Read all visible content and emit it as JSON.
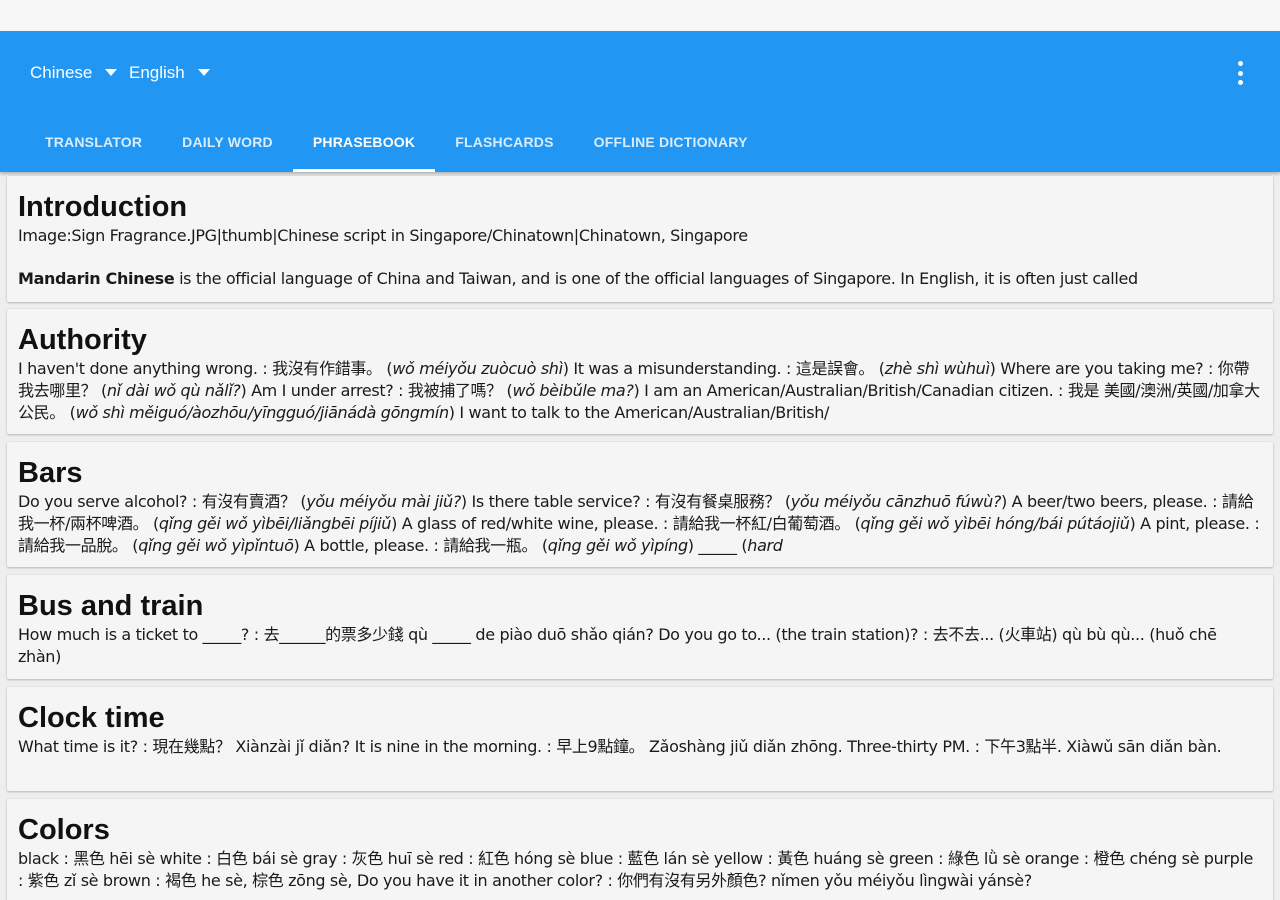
{
  "header": {
    "source_language": "Chinese",
    "target_language": "English",
    "menu_icon": "more-vert-icon",
    "dropdown_icon": "arrow-drop-down-icon",
    "accent_color": "#2196f3"
  },
  "tabs": [
    {
      "label": "TRANSLATOR",
      "active": false
    },
    {
      "label": "DAILY WORD",
      "active": false
    },
    {
      "label": "PHRASEBOOK",
      "active": true
    },
    {
      "label": "FLASHCARDS",
      "active": false
    },
    {
      "label": "OFFLINE DICTIONARY",
      "active": false
    }
  ],
  "sections": [
    {
      "title": "Introduction",
      "body_line": "Image:Sign Fragrance.JPG|thumb|Chinese script in Singapore/Chinatown|Chinatown, Singapore",
      "body_bold": "Mandarin Chinese",
      "body_rest": " is the official language of China and Taiwan, and is one of the official languages of Singapore. In English, it is often just called"
    },
    {
      "title": "Authority",
      "segments": [
        {
          "t": "I haven't done anything wrong. : 我沒有作錯事。 (",
          "i": false
        },
        {
          "t": "wǒ méiyǒu zuòcuò shì",
          "i": true
        },
        {
          "t": ") It was a misunderstanding. : 這是誤會。 (",
          "i": false
        },
        {
          "t": "zhè shì wùhuì",
          "i": true
        },
        {
          "t": ") Where are you taking me? : 你帶我去哪里？ (",
          "i": false
        },
        {
          "t": "nǐ dài wǒ qù nǎlǐ?",
          "i": true
        },
        {
          "t": ") Am I under arrest? : 我被捕了嗎？ (",
          "i": false
        },
        {
          "t": "wǒ bèibǔle ma?",
          "i": true
        },
        {
          "t": ") I am an American/Australian/British/Canadian citizen. : 我是 美國/澳洲/英國/加拿大 公民。 (",
          "i": false
        },
        {
          "t": "wǒ shì měiguó/àozhōu/yīngguó/jiānádà gōngmín",
          "i": true
        },
        {
          "t": ") I want to talk to the American/Australian/British/",
          "i": false
        }
      ]
    },
    {
      "title": "Bars",
      "segments": [
        {
          "t": "Do you serve alcohol? : 有沒有賣酒？ (",
          "i": false
        },
        {
          "t": "yǒu méiyǒu mài jiǔ?",
          "i": true
        },
        {
          "t": ") Is there table service? : 有沒有餐桌服務？ (",
          "i": false
        },
        {
          "t": "yǒu méiyǒu cānzhuō fúwù?",
          "i": true
        },
        {
          "t": ") A beer/two beers, please. : 請給我一杯/兩杯啤酒。 (",
          "i": false
        },
        {
          "t": "qǐng gěi wǒ yìbēi/liǎngbēi píjiǔ",
          "i": true
        },
        {
          "t": ") A glass of red/white wine, please. : 請給我一杯紅/白葡萄酒。 (",
          "i": false
        },
        {
          "t": "qǐng gěi wǒ yìbēi hóng/bái pútáojiǔ",
          "i": true
        },
        {
          "t": ") A pint, please. : 請給我一品脫。 (",
          "i": false
        },
        {
          "t": "qǐng gěi wǒ yìpǐntuō",
          "i": true
        },
        {
          "t": ") A bottle, please. : 請給我一瓶。 (",
          "i": false
        },
        {
          "t": "qǐng gěi wǒ yìpíng",
          "i": true
        },
        {
          "t": ") _____ (",
          "i": false
        },
        {
          "t": "hard",
          "i": true
        }
      ]
    },
    {
      "title": "Bus and train",
      "body": "How much is a ticket to _____? : 去______的票多少錢 qù _____ de piào duō shǎo qián? Do you go to... (the train station)? : 去不去... (火車站) qù bù qù... (huǒ chē zhàn)"
    },
    {
      "title": "Clock time",
      "body": "What time is it? : 現在幾點？ Xiànzài jǐ diǎn? It is nine in the morning. : 早上9點鐘。 Zǎoshàng jiǔ diǎn zhōng. Three-thirty PM. : 下午3點半. Xiàwǔ sān diǎn bàn."
    },
    {
      "title": "Colors",
      "body": "black : 黑色 hēi sè white : 白色 bái sè gray : 灰色 huī sè red : 紅色 hóng sè blue : 藍色 lán sè yellow : 黃色 huáng sè green : 綠色 lǜ sè orange : 橙色 chéng sè purple : 紫色 zǐ sè brown : 褐色 he sè, 棕色 zōng sè, Do you have it in another color? : 你們有沒有另外顏色? nǐmen yǒu méiyǒu lìngwài yánsè?"
    }
  ]
}
